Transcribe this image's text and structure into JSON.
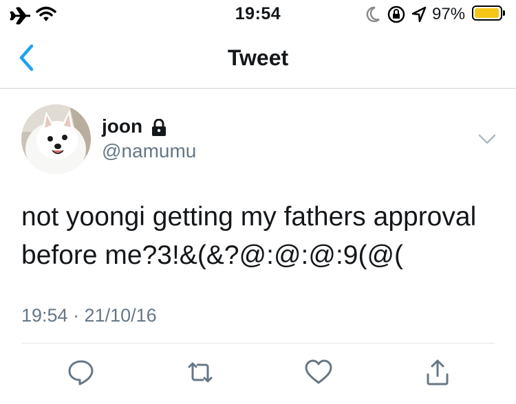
{
  "status_bar": {
    "time": "19:54",
    "battery_percent": "97%",
    "battery_level": 0.97,
    "battery_color": "#f5c518",
    "icons": [
      "airplane-icon",
      "wifi-icon",
      "moon-icon",
      "orientation-lock-icon",
      "location-arrow-icon",
      "battery-icon"
    ]
  },
  "nav": {
    "back_icon": "chevron-left-icon",
    "title": "Tweet",
    "accent_color": "#1da1f2"
  },
  "tweet": {
    "author_name": "joon",
    "author_handle": "@namumu",
    "protected_icon": "lock-icon",
    "text_line_1": "not yoongi getting my fathers approval",
    "text_line_2": "before me?3!&(&?@:@:@:9(@(",
    "timestamp": "19:54 · 21/10/16",
    "menu_icon": "chevron-down-icon"
  },
  "actions": [
    {
      "name": "reply",
      "icon": "reply-icon"
    },
    {
      "name": "retweet",
      "icon": "retweet-icon"
    },
    {
      "name": "like",
      "icon": "heart-icon"
    },
    {
      "name": "share",
      "icon": "share-icon"
    }
  ],
  "colors": {
    "icon_gray": "#657786",
    "text": "#14171a",
    "secondary_text": "#657786"
  }
}
